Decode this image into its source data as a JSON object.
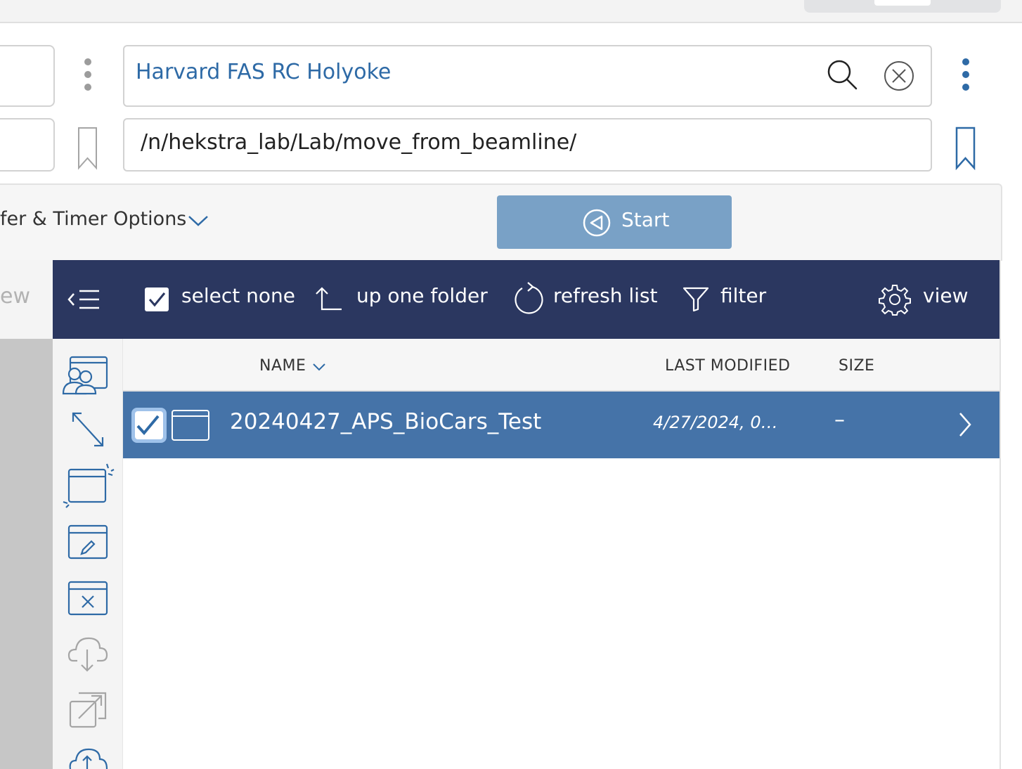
{
  "server": {
    "endpoint_name": "Harvard FAS RC Holyoke",
    "path": "/n/hekstra_lab/Lab/move_from_beamline/"
  },
  "options": {
    "label": "fer & Timer Options",
    "start_label": "Start"
  },
  "left_panel": {
    "partial_label": "ew"
  },
  "toolbar": {
    "select_none": "select none",
    "up_one_folder": "up one folder",
    "refresh_list": "refresh list",
    "filter": "filter",
    "view": "view"
  },
  "columns": {
    "name": "NAME",
    "last_modified": "LAST MODIFIED",
    "size": "SIZE"
  },
  "files": [
    {
      "name": "20240427_APS_BioCars_Test",
      "last_modified": "4/27/2024, 04:...",
      "size": "–",
      "selected": true,
      "type": "folder"
    }
  ],
  "colors": {
    "toolbar_bg": "#2b3760",
    "selected_row": "#4573a8",
    "accent_blue": "#2e6aa6",
    "start_button": "#79a1c6"
  },
  "icons": {
    "side_strip": [
      "share-collection-icon",
      "resize-arrows-icon",
      "new-folder-icon",
      "rename-folder-icon",
      "delete-folder-icon",
      "cloud-download-icon",
      "open-external-icon",
      "cloud-upload-icon"
    ]
  }
}
